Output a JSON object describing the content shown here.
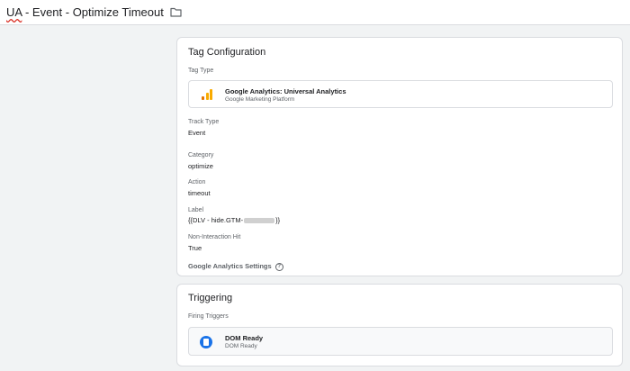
{
  "header": {
    "title_prefix": "UA",
    "title_rest": " - Event - Optimize Timeout",
    "icon": "folder-icon"
  },
  "tag_configuration": {
    "title": "Tag Configuration",
    "tag_type_label": "Tag Type",
    "tag_type": {
      "name": "Google Analytics: Universal Analytics",
      "provider": "Google Marketing Platform",
      "icon": "google-analytics-icon",
      "icon_colors": [
        "#f9ab00",
        "#e37400"
      ]
    },
    "fields": [
      {
        "label": "Track Type",
        "value": "Event"
      },
      {
        "label": "Category",
        "value": "optimize"
      },
      {
        "label": "Action",
        "value": "timeout"
      }
    ],
    "label_field": {
      "label": "Label",
      "value_prefix": "{{DLV - hide.GTM-",
      "value_suffix": "}}"
    },
    "non_interaction": {
      "label": "Non-Interaction Hit",
      "value": "True"
    },
    "ga_settings_label": "Google Analytics Settings",
    "help_glyph": "?"
  },
  "triggering": {
    "title": "Triggering",
    "firing_label": "Firing Triggers",
    "trigger": {
      "name": "DOM Ready",
      "type": "DOM Ready",
      "icon": "dom-ready-icon",
      "icon_color": "#1a73e8"
    }
  }
}
